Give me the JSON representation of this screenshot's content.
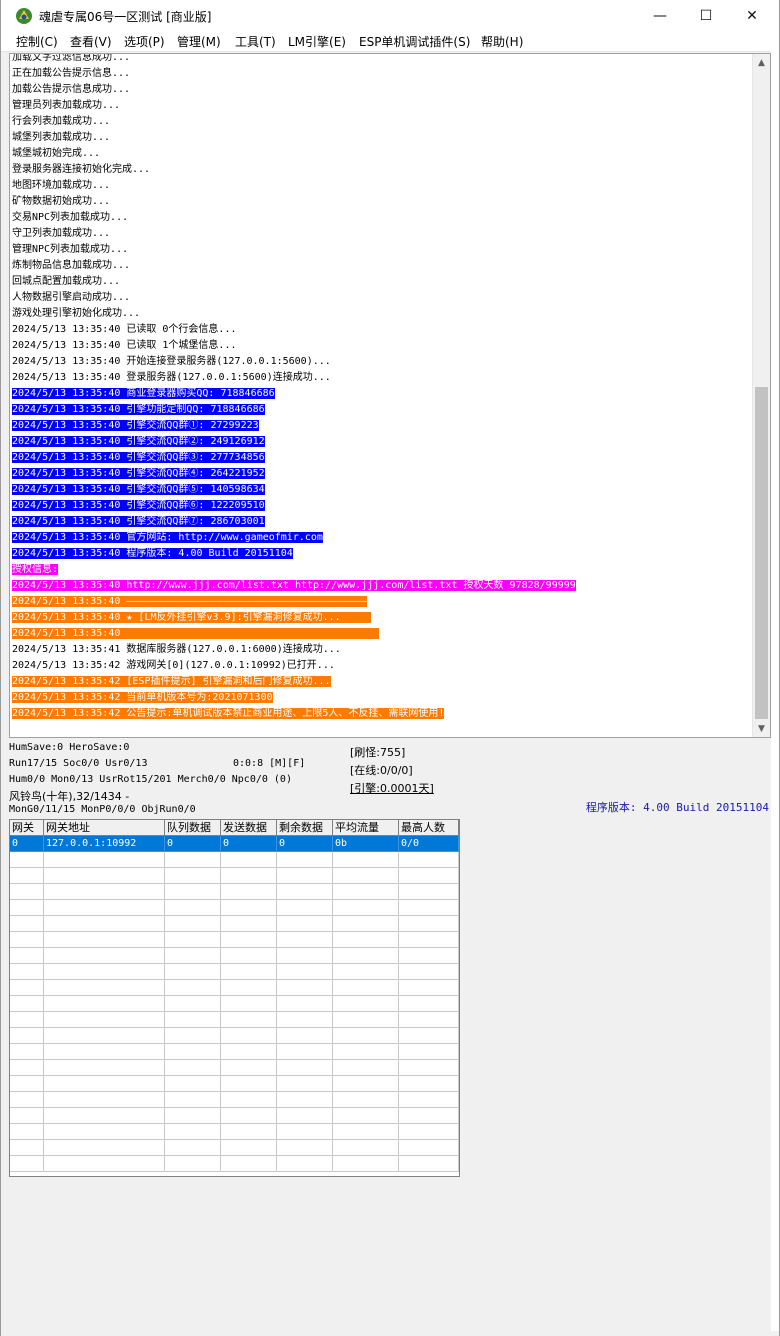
{
  "window": {
    "title": "魂虐专属06号一区测试 [商业版]",
    "minimize_glyph": "—",
    "maximize_glyph": "☐",
    "close_glyph": "✕"
  },
  "menu": [
    {
      "label": "控制(C)"
    },
    {
      "label": "查看(V)"
    },
    {
      "label": "选项(P)"
    },
    {
      "label": "管理(M)"
    },
    {
      "label": "工具(T)"
    },
    {
      "label": "LM引擎(E)"
    },
    {
      "label": "ESP单机调试插件(S)"
    },
    {
      "label": "帮助(H)"
    }
  ],
  "log": [
    {
      "text": "加载文字过滤信息成功...",
      "style": ""
    },
    {
      "text": "正在加载公告提示信息...",
      "style": ""
    },
    {
      "text": "加载公告提示信息成功...",
      "style": ""
    },
    {
      "text": "管理员列表加载成功...",
      "style": ""
    },
    {
      "text": "行会列表加载成功...",
      "style": ""
    },
    {
      "text": "城堡列表加载成功...",
      "style": ""
    },
    {
      "text": "城堡城初始完成...",
      "style": ""
    },
    {
      "text": "登录服务器连接初始化完成...",
      "style": ""
    },
    {
      "text": "地图环境加载成功...",
      "style": ""
    },
    {
      "text": "矿物数据初始成功...",
      "style": ""
    },
    {
      "text": "交易NPC列表加载成功...",
      "style": ""
    },
    {
      "text": "守卫列表加载成功...",
      "style": ""
    },
    {
      "text": "管理NPC列表加载成功...",
      "style": ""
    },
    {
      "text": "炼制物品信息加载成功...",
      "style": ""
    },
    {
      "text": "回城点配置加载成功...",
      "style": ""
    },
    {
      "text": "人物数据引擎启动成功...",
      "style": ""
    },
    {
      "text": "游戏处理引擎初始化成功...",
      "style": ""
    },
    {
      "text": "2024/5/13 13:35:40 已读取 0个行会信息...",
      "style": ""
    },
    {
      "text": "2024/5/13 13:35:40 已读取 1个城堡信息...",
      "style": ""
    },
    {
      "text": "2024/5/13 13:35:40 开始连接登录服务器(127.0.0.1:5600)...",
      "style": ""
    },
    {
      "text": "2024/5/13 13:35:40 登录服务器(127.0.0.1:5600)连接成功...",
      "style": ""
    },
    {
      "text": "2024/5/13 13:35:40 商业登录器购买QQ: 718846686",
      "style": "blue"
    },
    {
      "text": "2024/5/13 13:35:40 引擎功能定制QQ: 718846686",
      "style": "blue"
    },
    {
      "text": "2024/5/13 13:35:40 引擎交流QQ群①: 27299223",
      "style": "blue"
    },
    {
      "text": "2024/5/13 13:35:40 引擎交流QQ群②: 249126912",
      "style": "blue"
    },
    {
      "text": "2024/5/13 13:35:40 引擎交流QQ群③: 277734856",
      "style": "blue"
    },
    {
      "text": "2024/5/13 13:35:40 引擎交流QQ群④: 264221952",
      "style": "blue"
    },
    {
      "text": "2024/5/13 13:35:40 引擎交流QQ群⑤: 140598634",
      "style": "blue"
    },
    {
      "text": "2024/5/13 13:35:40 引擎交流QQ群⑥: 122209510",
      "style": "blue"
    },
    {
      "text": "2024/5/13 13:35:40 引擎交流QQ群⑦: 286703001",
      "style": "blue"
    },
    {
      "text": "2024/5/13 13:35:40 官方网站: http://www.gameofmir.com",
      "style": "blue"
    },
    {
      "text": "2024/5/13 13:35:40 程序版本: 4.00 Build 20151104",
      "style": "blue"
    },
    {
      "text": "授权信息:",
      "style": "magenta"
    },
    {
      "text": "2024/5/13 13:35:40 http://www.jjj.com/list.txt http://www.jjj.com/list.txt 授权天数 97828/99999",
      "style": "magenta"
    },
    {
      "text": "2024/5/13 13:35:40 ————————————————————————————————————————",
      "style": "orange"
    },
    {
      "text": "2024/5/13 13:35:40 ★ [LM反外挂引擎v3.9]:引擎漏洞修复成功...     ",
      "style": "orange"
    },
    {
      "text": "2024/5/13 13:35:40                                           ",
      "style": "orange"
    },
    {
      "text": "2024/5/13 13:35:41 数据库服务器(127.0.0.1:6000)连接成功...",
      "style": ""
    },
    {
      "text": "2024/5/13 13:35:42 游戏网关[0](127.0.0.1:10992)已打开...",
      "style": ""
    },
    {
      "text": "2024/5/13 13:35:42 [ESP插件提示] 引擎漏洞和后门修复成功...",
      "style": "orange"
    },
    {
      "text": "2024/5/13 13:35:42 当前单机版本号为:2021071300",
      "style": "orange"
    },
    {
      "text": "2024/5/13 13:35:42 公告提示:单机调试版本禁止商业用途、上限5人、不反挂、需联网使用!",
      "style": "orange"
    }
  ],
  "status": {
    "line1": "HumSave:0 HeroSave:0",
    "line2a": "Run17/15 Soc0/0 Usr0/13",
    "line2b": "0:0:8 [M][F]",
    "line3": "Hum0/0 Mon0/13 UsrRot15/201 Merch0/0 Npc0/0 (0)",
    "line4": "风铃鸟(十年),32/1434 -",
    "line5": "MonG0/11/15 MonP0/0/0 ObjRun0/0",
    "right1": "[刷怪:755]",
    "right2": "[在线:0/0/0]",
    "right3": "[引擎:0.0001天]",
    "version": "程序版本: 4.00 Build 20151104"
  },
  "grid": {
    "headers": [
      "网关",
      "网关地址",
      "队列数据",
      "发送数据",
      "剩余数据",
      "平均流量",
      "最高人数"
    ],
    "rows": [
      [
        "0",
        "127.0.0.1:10992",
        "0",
        "0",
        "0",
        "0b",
        "0/0"
      ]
    ]
  }
}
